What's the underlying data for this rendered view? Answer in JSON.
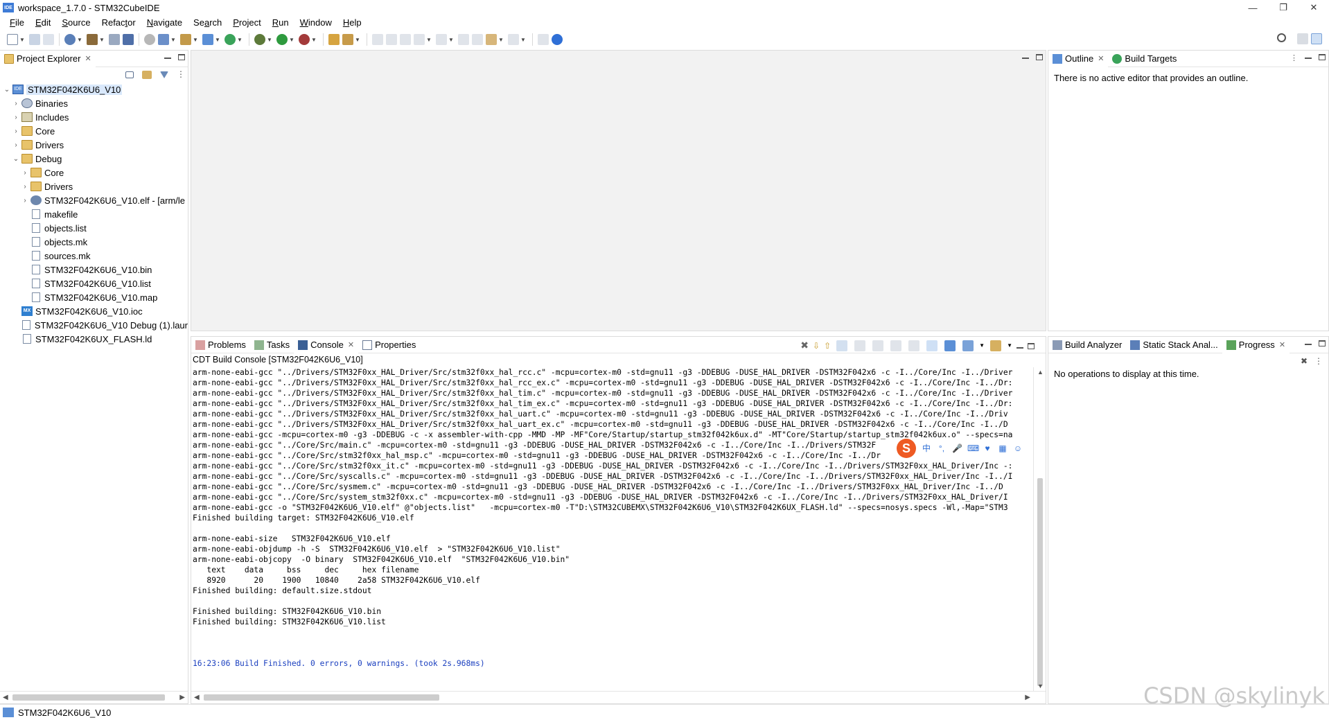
{
  "window": {
    "title": "workspace_1.7.0 - STM32CubeIDE",
    "app_badge": "IDE",
    "minimize": "—",
    "restore": "❐",
    "close": "✕"
  },
  "menu": [
    {
      "mn": "F",
      "rest": "ile"
    },
    {
      "mn": "E",
      "rest": "dit"
    },
    {
      "mn": "S",
      "rest": "ource"
    },
    {
      "mn": "",
      "rest": "Refac",
      "mn2": "t",
      "rest2": "or"
    },
    {
      "mn": "N",
      "rest": "avigate"
    },
    {
      "mn": "",
      "rest": "Se",
      "mn2": "a",
      "rest2": "rch"
    },
    {
      "mn": "P",
      "rest": "roject"
    },
    {
      "mn": "R",
      "rest": "un"
    },
    {
      "mn": "W",
      "rest": "indow"
    },
    {
      "mn": "H",
      "rest": "elp"
    }
  ],
  "project_explorer": {
    "tab_label": "Project Explorer",
    "tree": [
      {
        "label": "STM32F042K6U6_V10",
        "level": 0,
        "twisty": "v",
        "icon": "project",
        "selected": true
      },
      {
        "label": "Binaries",
        "level": 1,
        "twisty": ">",
        "icon": "bin"
      },
      {
        "label": "Includes",
        "level": 1,
        "twisty": ">",
        "icon": "inc"
      },
      {
        "label": "Core",
        "level": 1,
        "twisty": ">",
        "icon": "folder"
      },
      {
        "label": "Drivers",
        "level": 1,
        "twisty": ">",
        "icon": "folder"
      },
      {
        "label": "Debug",
        "level": 1,
        "twisty": "v",
        "icon": "folder"
      },
      {
        "label": "Core",
        "level": 2,
        "twisty": ">",
        "icon": "folder"
      },
      {
        "label": "Drivers",
        "level": 2,
        "twisty": ">",
        "icon": "folder"
      },
      {
        "label": "STM32F042K6U6_V10.elf - [arm/le",
        "level": 2,
        "twisty": ">",
        "icon": "elf"
      },
      {
        "label": "makefile",
        "level": 2,
        "twisty": "",
        "icon": "file"
      },
      {
        "label": "objects.list",
        "level": 2,
        "twisty": "",
        "icon": "file"
      },
      {
        "label": "objects.mk",
        "level": 2,
        "twisty": "",
        "icon": "file"
      },
      {
        "label": "sources.mk",
        "level": 2,
        "twisty": "",
        "icon": "file"
      },
      {
        "label": "STM32F042K6U6_V10.bin",
        "level": 2,
        "twisty": "",
        "icon": "file"
      },
      {
        "label": "STM32F042K6U6_V10.list",
        "level": 2,
        "twisty": "",
        "icon": "file"
      },
      {
        "label": "STM32F042K6U6_V10.map",
        "level": 2,
        "twisty": "",
        "icon": "file"
      },
      {
        "label": "STM32F042K6U6_V10.ioc",
        "level": 1,
        "twisty": "",
        "icon": "mx"
      },
      {
        "label": "STM32F042K6U6_V10 Debug (1).laur",
        "level": 1,
        "twisty": "",
        "icon": "file"
      },
      {
        "label": "STM32F042K6UX_FLASH.ld",
        "level": 1,
        "twisty": "",
        "icon": "file"
      }
    ]
  },
  "outline": {
    "tabs": [
      "Outline",
      "Build Targets"
    ],
    "message": "There is no active editor that provides an outline."
  },
  "console": {
    "tabs": [
      "Problems",
      "Tasks",
      "Console",
      "Properties"
    ],
    "title": "CDT Build Console [STM32F042K6U6_V10]",
    "lines": [
      "arm-none-eabi-gcc \"../Drivers/STM32F0xx_HAL_Driver/Src/stm32f0xx_hal_rcc.c\" -mcpu=cortex-m0 -std=gnu11 -g3 -DDEBUG -DUSE_HAL_DRIVER -DSTM32F042x6 -c -I../Core/Inc -I../Driver",
      "arm-none-eabi-gcc \"../Drivers/STM32F0xx_HAL_Driver/Src/stm32f0xx_hal_rcc_ex.c\" -mcpu=cortex-m0 -std=gnu11 -g3 -DDEBUG -DUSE_HAL_DRIVER -DSTM32F042x6 -c -I../Core/Inc -I../Dr:",
      "arm-none-eabi-gcc \"../Drivers/STM32F0xx_HAL_Driver/Src/stm32f0xx_hal_tim.c\" -mcpu=cortex-m0 -std=gnu11 -g3 -DDEBUG -DUSE_HAL_DRIVER -DSTM32F042x6 -c -I../Core/Inc -I../Driver",
      "arm-none-eabi-gcc \"../Drivers/STM32F0xx_HAL_Driver/Src/stm32f0xx_hal_tim_ex.c\" -mcpu=cortex-m0 -std=gnu11 -g3 -DDEBUG -DUSE_HAL_DRIVER -DSTM32F042x6 -c -I../Core/Inc -I../Dr:",
      "arm-none-eabi-gcc \"../Drivers/STM32F0xx_HAL_Driver/Src/stm32f0xx_hal_uart.c\" -mcpu=cortex-m0 -std=gnu11 -g3 -DDEBUG -DUSE_HAL_DRIVER -DSTM32F042x6 -c -I../Core/Inc -I../Driv",
      "arm-none-eabi-gcc \"../Drivers/STM32F0xx_HAL_Driver/Src/stm32f0xx_hal_uart_ex.c\" -mcpu=cortex-m0 -std=gnu11 -g3 -DDEBUG -DUSE_HAL_DRIVER -DSTM32F042x6 -c -I../Core/Inc -I../D",
      "arm-none-eabi-gcc -mcpu=cortex-m0 -g3 -DDEBUG -c -x assembler-with-cpp -MMD -MP -MF\"Core/Startup/startup_stm32f042k6ux.d\" -MT\"Core/Startup/startup_stm32f042k6ux.o\" --specs=na",
      "arm-none-eabi-gcc \"../Core/Src/main.c\" -mcpu=cortex-m0 -std=gnu11 -g3 -DDEBUG -DUSE_HAL_DRIVER -DSTM32F042x6 -c -I../Core/Inc -I../Drivers/STM32F",
      "arm-none-eabi-gcc \"../Core/Src/stm32f0xx_hal_msp.c\" -mcpu=cortex-m0 -std=gnu11 -g3 -DDEBUG -DUSE_HAL_DRIVER -DSTM32F042x6 -c -I../Core/Inc -I../Dr",
      "arm-none-eabi-gcc \"../Core/Src/stm32f0xx_it.c\" -mcpu=cortex-m0 -std=gnu11 -g3 -DDEBUG -DUSE_HAL_DRIVER -DSTM32F042x6 -c -I../Core/Inc -I../Drivers/STM32F0xx_HAL_Driver/Inc -:",
      "arm-none-eabi-gcc \"../Core/Src/syscalls.c\" -mcpu=cortex-m0 -std=gnu11 -g3 -DDEBUG -DUSE_HAL_DRIVER -DSTM32F042x6 -c -I../Core/Inc -I../Drivers/STM32F0xx_HAL_Driver/Inc -I../I",
      "arm-none-eabi-gcc \"../Core/Src/sysmem.c\" -mcpu=cortex-m0 -std=gnu11 -g3 -DDEBUG -DUSE_HAL_DRIVER -DSTM32F042x6 -c -I../Core/Inc -I../Drivers/STM32F0xx_HAL_Driver/Inc -I../D",
      "arm-none-eabi-gcc \"../Core/Src/system_stm32f0xx.c\" -mcpu=cortex-m0 -std=gnu11 -g3 -DDEBUG -DUSE_HAL_DRIVER -DSTM32F042x6 -c -I../Core/Inc -I../Drivers/STM32F0xx_HAL_Driver/I",
      "arm-none-eabi-gcc -o \"STM32F042K6U6_V10.elf\" @\"objects.list\"   -mcpu=cortex-m0 -T\"D:\\STM32CUBEMX\\STM32F042K6U6_V10\\STM32F042K6UX_FLASH.ld\" --specs=nosys.specs -Wl,-Map=\"STM3",
      "Finished building target: STM32F042K6U6_V10.elf",
      " ",
      "arm-none-eabi-size   STM32F042K6U6_V10.elf",
      "arm-none-eabi-objdump -h -S  STM32F042K6U6_V10.elf  > \"STM32F042K6U6_V10.list\"",
      "arm-none-eabi-objcopy  -O binary  STM32F042K6U6_V10.elf  \"STM32F042K6U6_V10.bin\"",
      "   text\t   data\t    bss\t    dec\t    hex\tfilename",
      "   8920\t     20\t   1900\t  10840\t   2a58\tSTM32F042K6U6_V10.elf",
      "Finished building: default.size.stdout",
      " ",
      "Finished building: STM32F042K6U6_V10.bin",
      "Finished building: STM32F042K6U6_V10.list",
      " ",
      " ",
      " "
    ],
    "build_result": "16:23:06 Build Finished. 0 errors, 0 warnings. (took 2s.968ms)"
  },
  "progress": {
    "tabs": [
      "Build Analyzer",
      "Static Stack Anal...",
      "Progress"
    ],
    "message": "No operations to display at this time."
  },
  "status": {
    "text": "STM32F042K6U6_V10"
  },
  "watermark": "CSDN @skylinyk",
  "ime": {
    "logo": "S",
    "items": [
      "中",
      "°,",
      "🎤",
      "⌨",
      "♥",
      "▦",
      "☺"
    ]
  }
}
